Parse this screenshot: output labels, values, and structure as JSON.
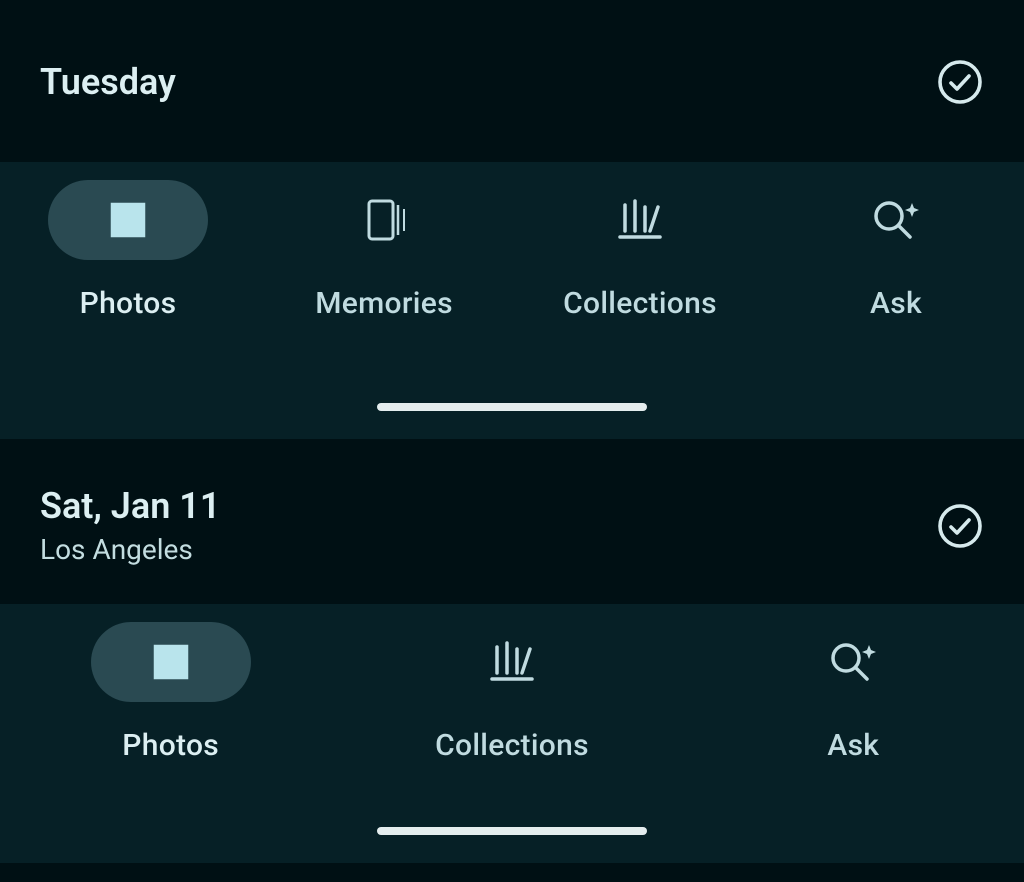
{
  "sections": [
    {
      "title": "Tuesday",
      "subtitle": null
    },
    {
      "title": "Sat, Jan 11",
      "subtitle": "Los Angeles"
    }
  ],
  "nav1": {
    "items": [
      {
        "label": "Photos",
        "active": true
      },
      {
        "label": "Memories",
        "active": false
      },
      {
        "label": "Collections",
        "active": false
      },
      {
        "label": "Ask",
        "active": false
      }
    ]
  },
  "nav2": {
    "items": [
      {
        "label": "Photos",
        "active": true
      },
      {
        "label": "Collections",
        "active": false
      },
      {
        "label": "Ask",
        "active": false
      }
    ]
  }
}
